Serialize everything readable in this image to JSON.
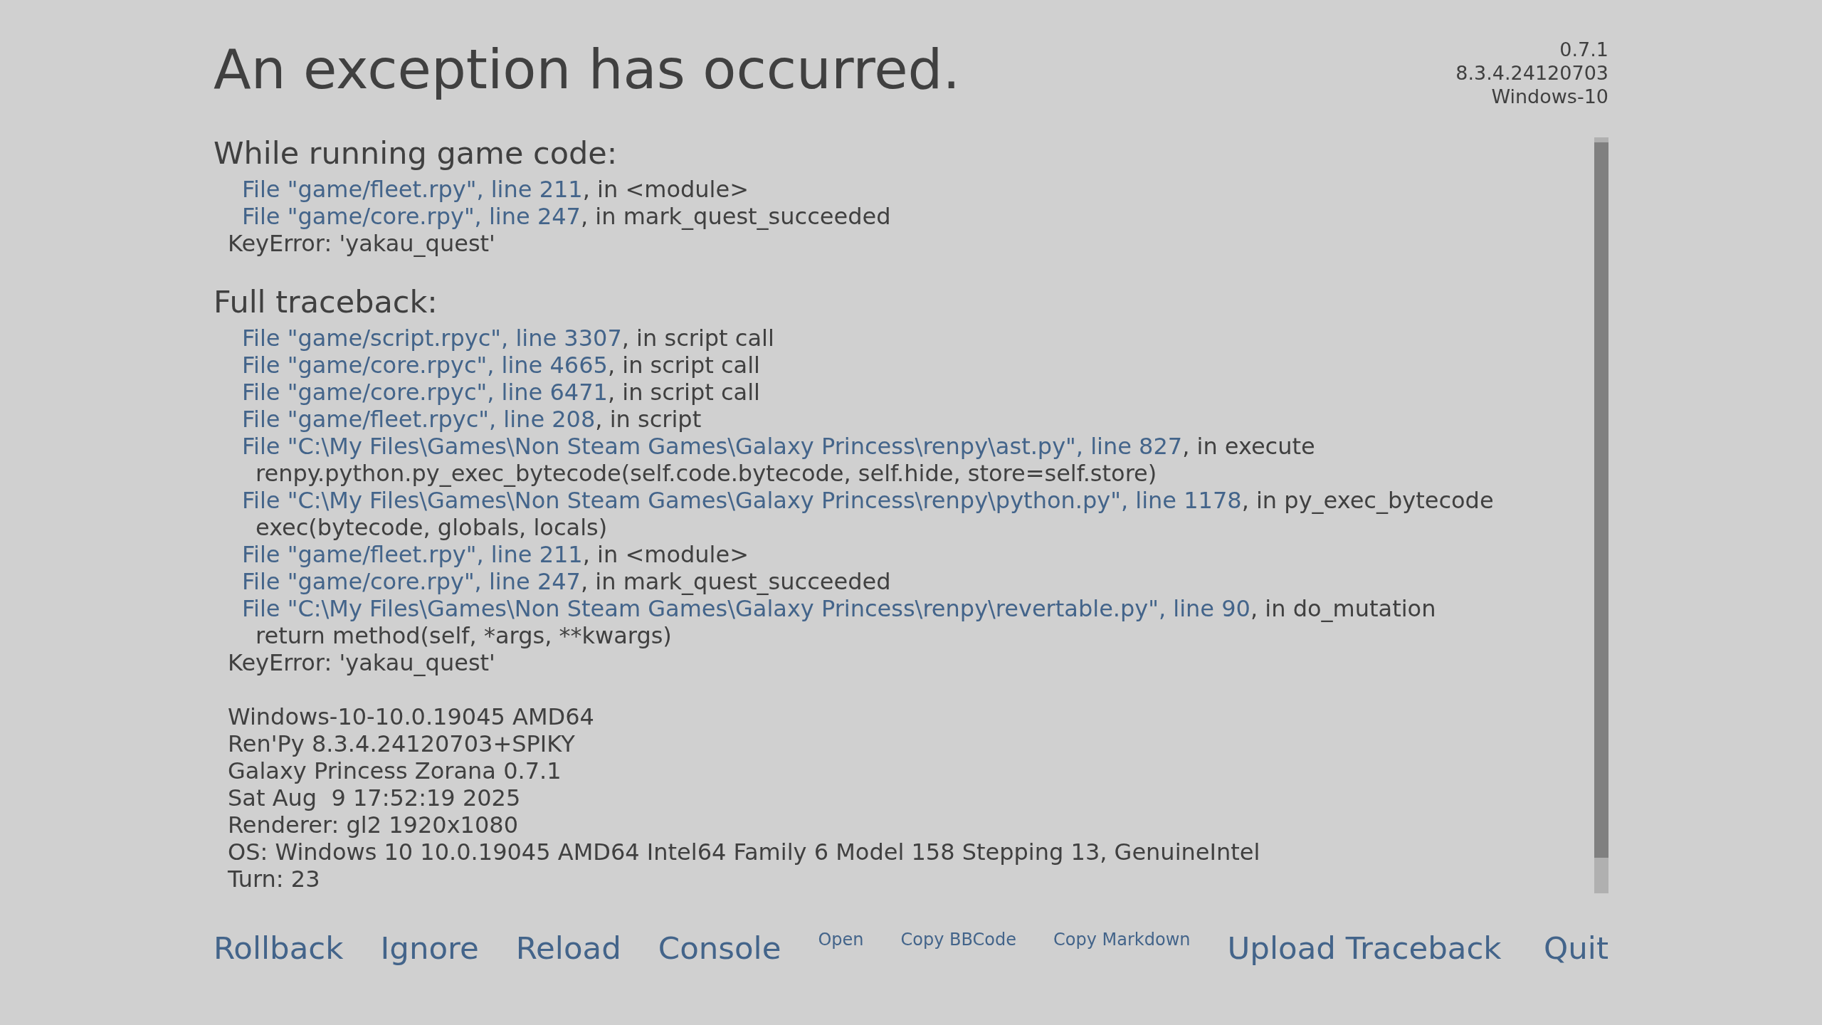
{
  "title": "An exception has occurred.",
  "version_info": [
    "0.7.1",
    "8.3.4.24120703",
    "Windows-10"
  ],
  "sections": [
    {
      "heading": "While running game code:",
      "lines": [
        {
          "kind": "frame",
          "location": "File \"game/fleet.rpy\", line 211",
          "context": ", in <module>"
        },
        {
          "kind": "frame",
          "location": "File \"game/core.rpy\", line 247",
          "context": ", in mark_quest_succeeded"
        },
        {
          "kind": "error",
          "text": "KeyError: 'yakau_quest'"
        }
      ]
    },
    {
      "heading": "Full traceback:",
      "lines": [
        {
          "kind": "frame",
          "location": "File \"game/script.rpyc\", line 3307",
          "context": ", in script call"
        },
        {
          "kind": "frame",
          "location": "File \"game/core.rpyc\", line 4665",
          "context": ", in script call"
        },
        {
          "kind": "frame",
          "location": "File \"game/core.rpyc\", line 6471",
          "context": ", in script call"
        },
        {
          "kind": "frame",
          "location": "File \"game/fleet.rpyc\", line 208",
          "context": ", in script"
        },
        {
          "kind": "frame",
          "location": "File \"C:\\My Files\\Games\\Non Steam Games\\Galaxy Princess\\renpy\\ast.py\", line 827",
          "context": ", in execute"
        },
        {
          "kind": "code",
          "text": "renpy.python.py_exec_bytecode(self.code.bytecode, self.hide, store=self.store)"
        },
        {
          "kind": "frame",
          "location": "File \"C:\\My Files\\Games\\Non Steam Games\\Galaxy Princess\\renpy\\python.py\", line 1178",
          "context": ", in py_exec_bytecode"
        },
        {
          "kind": "code",
          "text": "exec(bytecode, globals, locals)"
        },
        {
          "kind": "frame",
          "location": "File \"game/fleet.rpy\", line 211",
          "context": ", in <module>"
        },
        {
          "kind": "frame",
          "location": "File \"game/core.rpy\", line 247",
          "context": ", in mark_quest_succeeded"
        },
        {
          "kind": "frame",
          "location": "File \"C:\\My Files\\Games\\Non Steam Games\\Galaxy Princess\\renpy\\revertable.py\", line 90",
          "context": ", in do_mutation"
        },
        {
          "kind": "code",
          "text": "return method(self, *args, **kwargs)"
        },
        {
          "kind": "error",
          "text": "KeyError: 'yakau_quest'"
        }
      ],
      "system_info": [
        "Windows-10-10.0.19045 AMD64",
        "Ren'Py 8.3.4.24120703+SPIKY",
        "Galaxy Princess Zorana 0.7.1",
        "Sat Aug  9 17:52:19 2025",
        "Renderer: gl2 1920x1080",
        "OS: Windows 10 10.0.19045 AMD64 Intel64 Family 6 Model 158 Stepping 13, GenuineIntel",
        "Turn: 23"
      ]
    }
  ],
  "buttons": [
    {
      "label": "Rollback",
      "kind": "large"
    },
    {
      "label": "Ignore",
      "kind": "large"
    },
    {
      "label": "Reload",
      "kind": "large"
    },
    {
      "label": "Console",
      "kind": "large"
    },
    {
      "label": "Open",
      "kind": "small"
    },
    {
      "label": "Copy BBCode",
      "kind": "small"
    },
    {
      "label": "Copy Markdown",
      "kind": "small"
    },
    {
      "label": "Upload Traceback",
      "kind": "large"
    }
  ],
  "end_buttons": [
    {
      "label": "Quit",
      "kind": "large"
    }
  ]
}
